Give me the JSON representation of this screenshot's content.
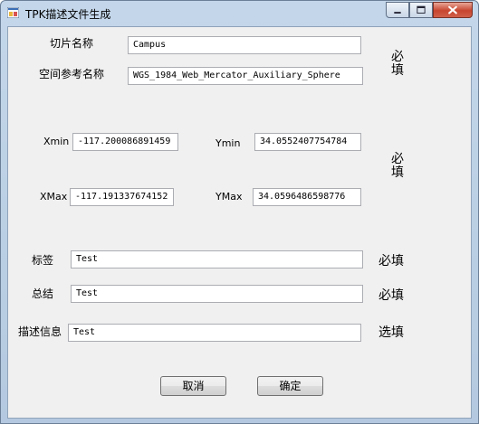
{
  "window": {
    "title": "TPK描述文件生成"
  },
  "form": {
    "slice_name": {
      "label": "切片名称",
      "value": "Campus"
    },
    "spatial_ref": {
      "label": "空间参考名称",
      "value": "WGS_1984_Web_Mercator_Auxiliary_Sphere"
    },
    "required_top": "必填",
    "xmin": {
      "label": "Xmin",
      "value": "-117.200086891459"
    },
    "ymin": {
      "label": "Ymin",
      "value": "34.0552407754784"
    },
    "xmax": {
      "label": "XMax",
      "value": "-117.191337674152"
    },
    "ymax": {
      "label": "YMax",
      "value": "34.0596486598776"
    },
    "required_coords": "必填",
    "tags": {
      "label": "标签",
      "value": "Test",
      "note": "必填"
    },
    "summary": {
      "label": "总结",
      "value": "Test",
      "note": "必填"
    },
    "description": {
      "label": "描述信息",
      "value": "Test",
      "note": "选填"
    }
  },
  "buttons": {
    "cancel": "取消",
    "ok": "确定"
  }
}
